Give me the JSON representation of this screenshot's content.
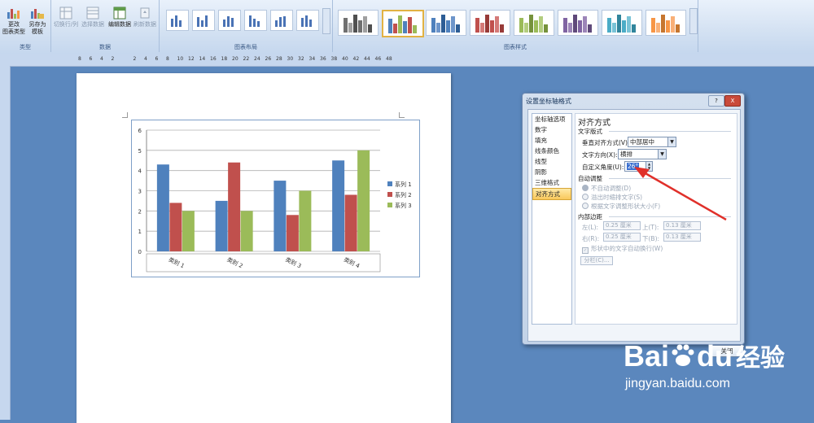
{
  "ribbon": {
    "groups": {
      "type": "类型",
      "data": "数据",
      "layout": "图表布局",
      "styles": "图表样式"
    },
    "buttons": {
      "change_type_1": "更改",
      "change_type_2": "图表类型",
      "save_template_1": "另存为",
      "save_template_2": "模板",
      "switch_row_col": "切换行/列",
      "select_data": "选择数据",
      "edit_data": "编辑数据",
      "refresh_data": "刷新数据"
    },
    "style_palette": [
      [
        "#707070",
        "#a0a0a0",
        "#505050"
      ],
      [
        "#4f81bd",
        "#c0504d",
        "#9bbb59"
      ],
      [
        "#4f81bd",
        "#6d95ca",
        "#2d5d95"
      ],
      [
        "#c0504d",
        "#d47a78",
        "#983b38"
      ],
      [
        "#9bbb59",
        "#b3cd7e",
        "#76923c"
      ],
      [
        "#8064a2",
        "#9c85b8",
        "#5f497a"
      ],
      [
        "#4bacc6",
        "#79c3d6",
        "#31859c"
      ],
      [
        "#f79646",
        "#f9b077",
        "#c6762f"
      ]
    ],
    "colors": {
      "accent_blue": "#4f81bd",
      "accent_red": "#c0504d",
      "accent_green": "#9bbb59"
    }
  },
  "ruler": {
    "h_ticks": [
      "8",
      "6",
      "4",
      "2",
      "",
      "2",
      "4",
      "6",
      "8",
      "10",
      "12",
      "14",
      "16",
      "18",
      "20",
      "22",
      "24",
      "26",
      "28",
      "30",
      "32",
      "34",
      "36",
      "38",
      "40",
      "42",
      "44",
      "46",
      "48"
    ]
  },
  "chart_data": {
    "type": "bar",
    "categories": [
      "类别 1",
      "类别 2",
      "类别 3",
      "类别 4"
    ],
    "series": [
      {
        "name": "系列 1",
        "values": [
          4.3,
          2.5,
          3.5,
          4.5
        ],
        "color": "#4f81bd"
      },
      {
        "name": "系列 2",
        "values": [
          2.4,
          4.4,
          1.8,
          2.8
        ],
        "color": "#c0504d"
      },
      {
        "name": "系列 3",
        "values": [
          2.0,
          2.0,
          3.0,
          5.0
        ],
        "color": "#9bbb59"
      }
    ],
    "ylim": [
      0,
      6
    ],
    "yticks": [
      "0",
      "1",
      "2",
      "3",
      "4",
      "5",
      "6"
    ],
    "x_label_rotation": 26,
    "legend": "right",
    "grid": true
  },
  "dialog": {
    "title": "设置坐标轴格式",
    "title_buttons": {
      "help": "?",
      "close": "X"
    },
    "nav": [
      "坐标轴选项",
      "数字",
      "填充",
      "线条颜色",
      "线型",
      "阴影",
      "三维格式",
      "对齐方式"
    ],
    "nav_selected": 7,
    "pane": {
      "heading": "对齐方式",
      "text_layout": "文字版式",
      "vertical_align_label": "垂直对齐方式(V):",
      "vertical_align_value": "中部居中",
      "text_direction_label": "文字方向(X):",
      "text_direction_value": "横排",
      "custom_angle_label": "自定义角度(U):",
      "custom_angle_value": "26°",
      "autofit": "自动调整",
      "autofit_none": "不自动调整(D)",
      "autofit_overflow": "溢出时缩排文字(S)",
      "autofit_resize": "根据文字调整形状大小(F)",
      "internal_margin": "内部边距",
      "left_label": "左(L):",
      "left_value": "0.25 厘米",
      "top_label": "上(T):",
      "top_value": "0.13 厘米",
      "right_label": "右(R):",
      "right_value": "0.25 厘米",
      "bottom_label": "下(B):",
      "bottom_value": "0.13 厘米",
      "wrap_text": "形状中的文字自动换行(W)",
      "columns_button": "分栏(C)..."
    },
    "close_button": "关闭"
  },
  "watermark": {
    "brand_bai": "Bai",
    "brand_du": "du",
    "brand_cn": "经验",
    "url": "jingyan.baidu.com"
  }
}
